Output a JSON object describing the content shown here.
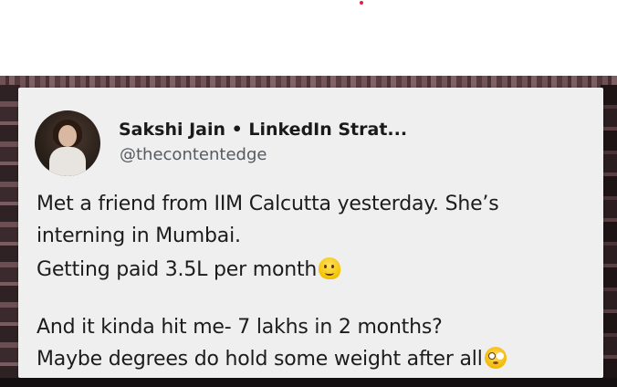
{
  "post": {
    "author": "Sakshi Jain • LinkedIn Strat...",
    "handle": "@thecontentedge",
    "lines": [
      "Met a friend from IIM Calcutta yesterday. She’s",
      "interning in Mumbai.",
      "Getting paid 3.5L per month",
      "And it kinda hit me- 7 lakhs in 2 months?",
      "Maybe degrees do hold some weight after all"
    ],
    "emojis": [
      "melting-face",
      "flushed-face"
    ]
  },
  "colors": {
    "card_background": "#efeff0",
    "text": "#1c1c1c",
    "handle_text": "#555b60",
    "accent_dot": "#e0223a"
  }
}
